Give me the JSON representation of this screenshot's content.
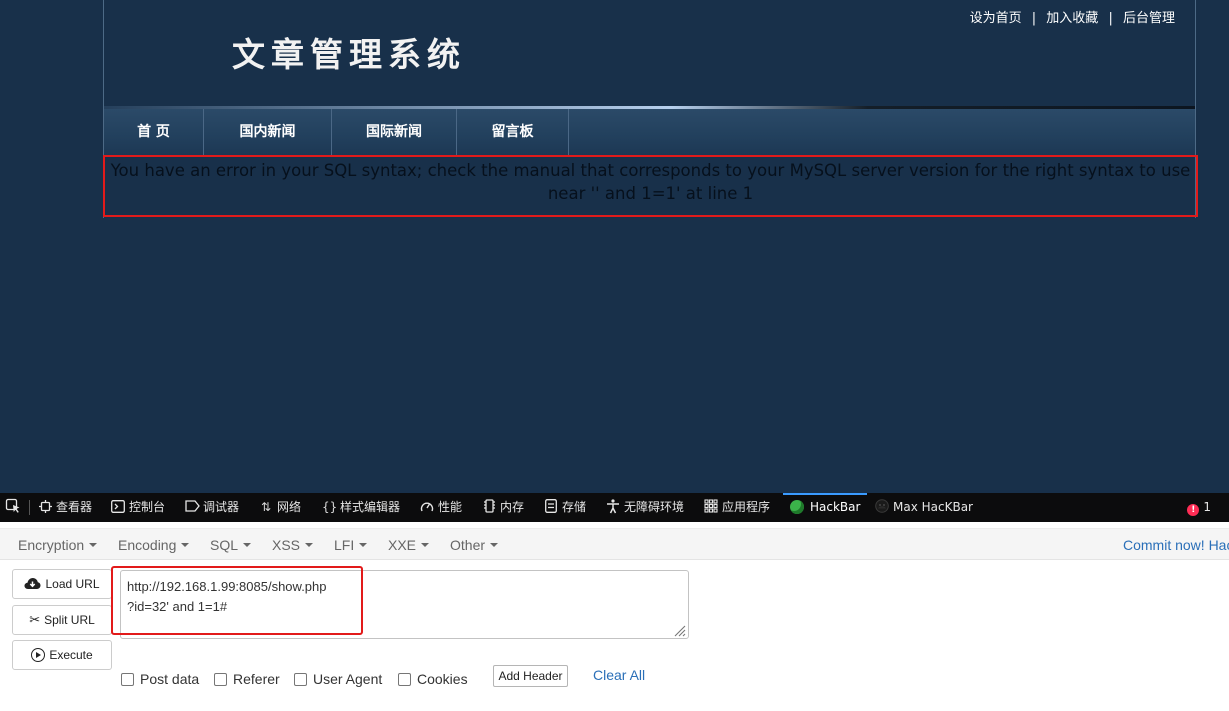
{
  "site": {
    "top_links": [
      "设为首页",
      "加入收藏",
      "后台管理"
    ],
    "separator": "|",
    "logo_text": "文章管理系统",
    "nav": [
      "首 页",
      "国内新闻",
      "国际新闻",
      "留言板"
    ],
    "error_message": "You have an error in your SQL syntax; check the manual that corresponds to your MySQL server version for the right syntax to use near '' and 1=1' at line 1"
  },
  "devtools": {
    "tabs": [
      {
        "label": "查看器",
        "icon": "inspector-icon"
      },
      {
        "label": "控制台",
        "icon": "console-icon"
      },
      {
        "label": "调试器",
        "icon": "debugger-icon"
      },
      {
        "label": "网络",
        "icon": "network-icon"
      },
      {
        "label": "样式编辑器",
        "icon": "style-editor-icon"
      },
      {
        "label": "性能",
        "icon": "performance-icon"
      },
      {
        "label": "内存",
        "icon": "memory-icon"
      },
      {
        "label": "存储",
        "icon": "storage-icon"
      },
      {
        "label": "无障碍环境",
        "icon": "accessibility-icon"
      },
      {
        "label": "应用程序",
        "icon": "application-icon"
      },
      {
        "label": "HackBar",
        "icon": "hackbar-icon"
      },
      {
        "label": "Max HacKBar",
        "icon": "max-hackbar-icon"
      }
    ],
    "active_tab": "HackBar",
    "error_count": "1",
    "colors": {
      "active_underline": "#3a9bff",
      "error_badge": "#ff2d55"
    }
  },
  "hackbar": {
    "menu": [
      "Encryption",
      "Encoding",
      "SQL",
      "XSS",
      "LFI",
      "XXE",
      "Other"
    ],
    "commit_label": "Commit now! Hackbar",
    "buttons": {
      "load": "Load URL",
      "split": "Split URL",
      "execute": "Execute"
    },
    "url_value": "http://192.168.1.99:8085/show.php\n?id=32' and 1=1#",
    "checkboxes": [
      "Post data",
      "Referer",
      "User Agent",
      "Cookies"
    ],
    "add_header_label": "Add Header",
    "clear_all_label": "Clear All",
    "colors": {
      "link": "#2a6fb8",
      "highlight_box": "#e21a1a"
    }
  }
}
